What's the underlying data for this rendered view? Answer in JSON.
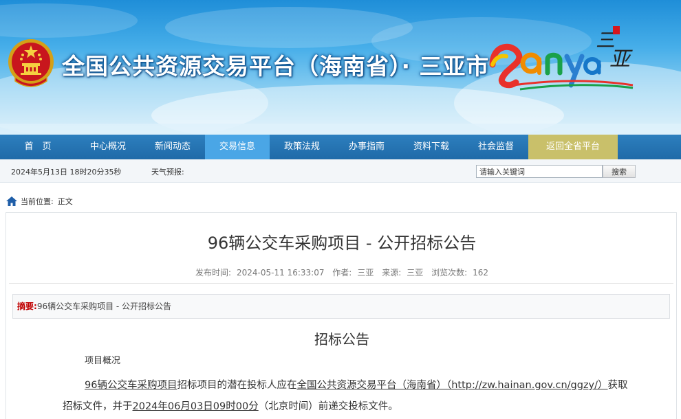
{
  "header": {
    "site_title": "全国公共资源交易平台（海南省）· 三亚市",
    "logo_text": "Sanya 三亚"
  },
  "nav": {
    "items": [
      {
        "label": "首　页"
      },
      {
        "label": "中心概况"
      },
      {
        "label": "新闻动态"
      },
      {
        "label": "交易信息",
        "active": true
      },
      {
        "label": "政策法规"
      },
      {
        "label": "办事指南"
      },
      {
        "label": "资料下载"
      },
      {
        "label": "社会监督"
      },
      {
        "label": "返回全省平台"
      }
    ]
  },
  "infobar": {
    "datetime": "2024年5月13日 18时20分35秒",
    "weather_label": "天气预报:",
    "search_placeholder": "请输入关键词",
    "search_button": "搜索"
  },
  "breadcrumb": {
    "label": "当前位置:",
    "current": "正文"
  },
  "article": {
    "title": "96辆公交车采购项目 - 公开招标公告",
    "meta": {
      "publish_label": "发布时间:",
      "publish_time": "2024-05-11 16:33:07",
      "author_label": "作者:",
      "author": "三亚",
      "source_label": "来源:",
      "source": "三亚",
      "views_label": "浏览次数:",
      "views": "162"
    },
    "summary_label": "摘要:",
    "summary_text": "96辆公交车采购项目 - 公开招标公告",
    "section_heading": "招标公告",
    "para_overview": "项目概况",
    "para_body": {
      "p1": "96辆公交车采购项目",
      "p2": "招标项目的潜在投标人应在",
      "p3": "全国公共资源交易平台（海南省）（http://zw.hainan.gov.cn/ggzy/）",
      "p4": "获取招标文件，并于",
      "p5": "2024年06月03日09时00分",
      "p6": "（北京时间）前递交投标文件。"
    }
  },
  "colors": {
    "nav_bg": "#2274b3",
    "nav_active": "#4aa6e6",
    "nav_back": "#c9c06a",
    "summary_label": "#c00000"
  }
}
